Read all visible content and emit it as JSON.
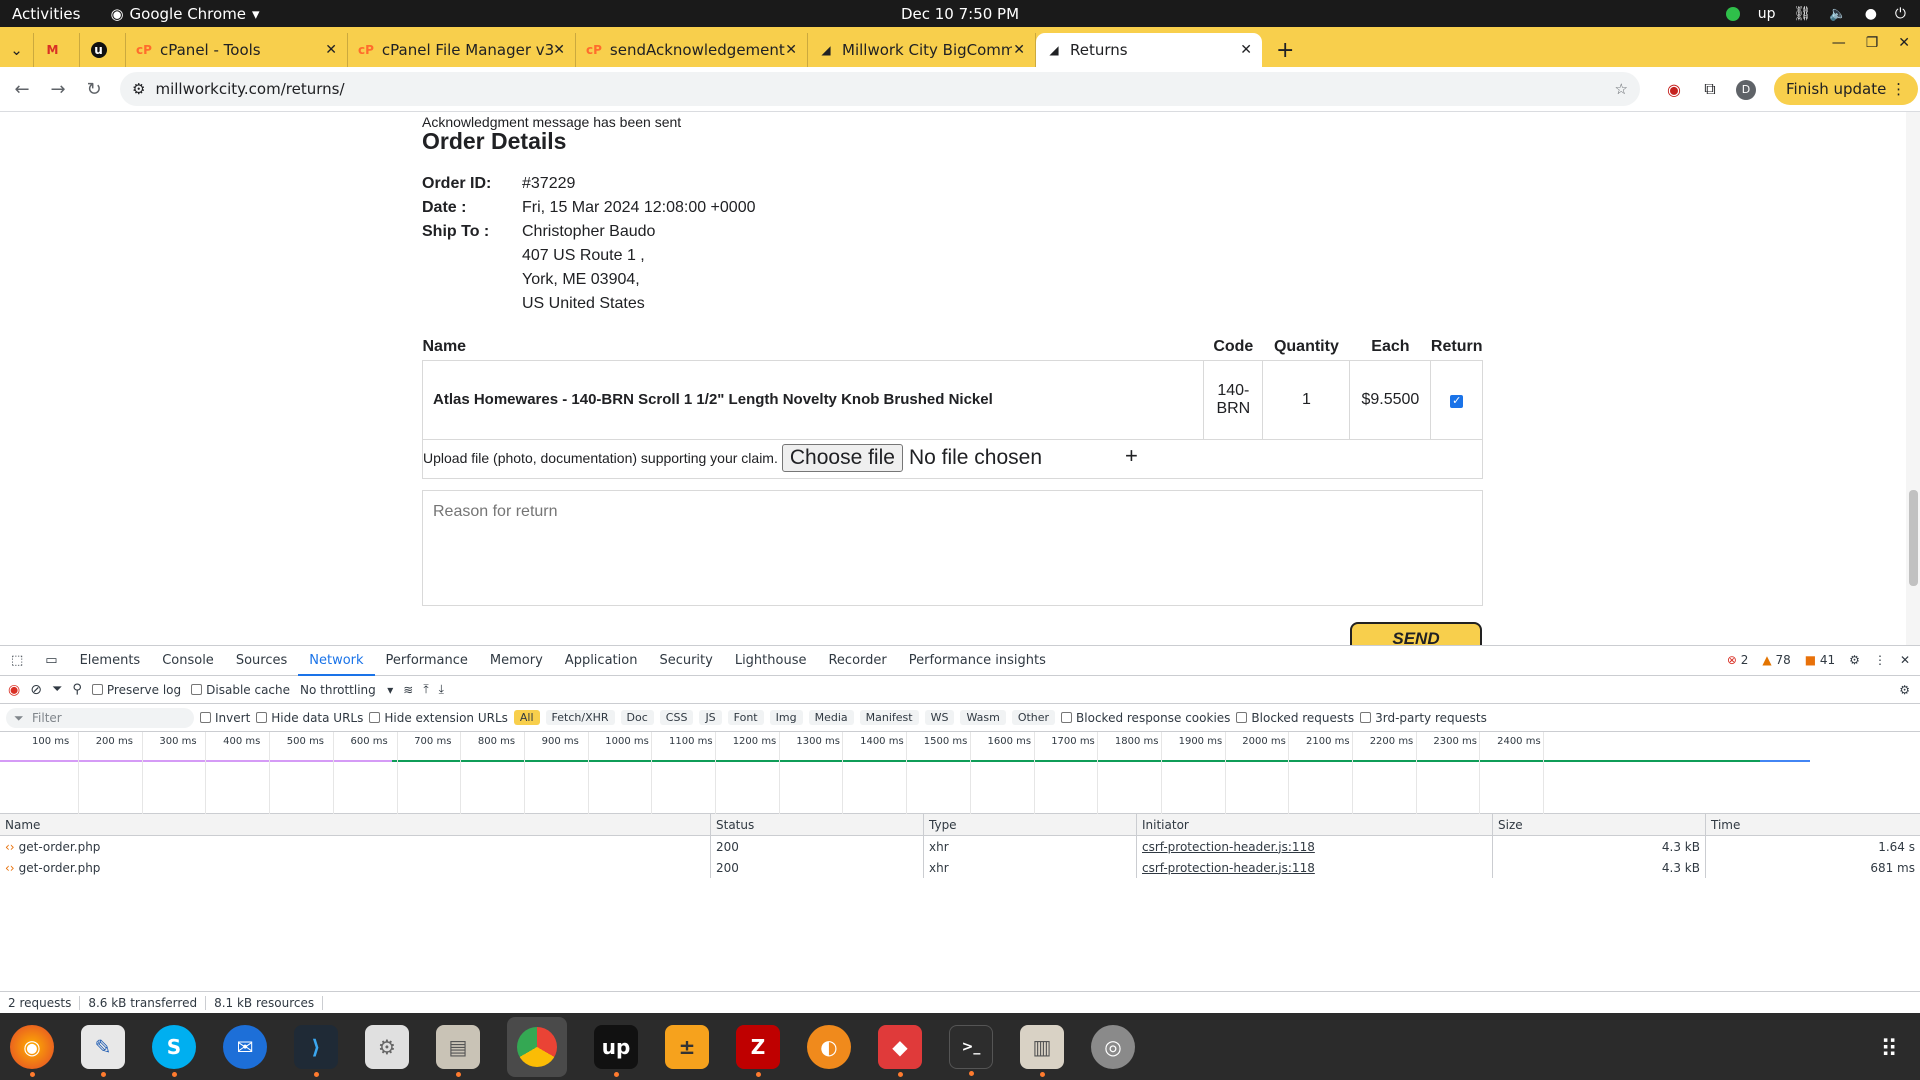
{
  "system": {
    "activities": "Activities",
    "app_name": "Google Chrome",
    "clock": "Dec 10  7:50 PM"
  },
  "tabs": [
    {
      "label": "cPanel - Tools"
    },
    {
      "label": "cPanel File Manager v3"
    },
    {
      "label": "sendAcknowledgement."
    },
    {
      "label": "Millwork City BigComme"
    },
    {
      "label": "Returns"
    }
  ],
  "address": {
    "url": "millworkcity.com/returns/",
    "finish_update": "Finish update",
    "profile_initial": "D"
  },
  "page": {
    "ack_message": "Acknowledgment message has been sent",
    "title": "Order Details",
    "order_id_label": "Order ID:",
    "order_id": "#37229",
    "date_label": "Date :",
    "date": "Fri, 15 Mar 2024 12:08:00 +0000",
    "ship_to_label": "Ship To :",
    "ship_name": "Christopher Baudo",
    "ship_line1": "407 US Route 1 ,",
    "ship_line2": "York, ME 03904,",
    "ship_line3": "US United States",
    "table": {
      "headers": [
        "Name",
        "Code",
        "Quantity",
        "Each",
        "Return"
      ],
      "row": {
        "name": "Atlas Homewares - 140-BRN Scroll 1 1/2\" Length Novelty Knob Brushed Nickel",
        "code_1": "140-",
        "code_2": "BRN",
        "quantity": "1",
        "each": "$9.5500",
        "return_checked": true
      }
    },
    "upload_label": "Upload file (photo, documentation) supporting your claim.",
    "choose_file": "Choose file",
    "no_file": "No file chosen",
    "reason_placeholder": "Reason for return",
    "send_button": "SEND REQUEST"
  },
  "devtools": {
    "tabs": [
      "Elements",
      "Console",
      "Sources",
      "Network",
      "Performance",
      "Memory",
      "Application",
      "Security",
      "Lighthouse",
      "Recorder",
      "Performance insights"
    ],
    "active_tab": "Network",
    "errors": "2",
    "warnings": "78",
    "issues": "41",
    "preserve_log": "Preserve log",
    "disable_cache": "Disable cache",
    "throttling": "No throttling",
    "filter_placeholder": "Filter",
    "invert": "Invert",
    "hide_data_urls": "Hide data URLs",
    "hide_ext_urls": "Hide extension URLs",
    "types": [
      "All",
      "Fetch/XHR",
      "Doc",
      "CSS",
      "JS",
      "Font",
      "Img",
      "Media",
      "Manifest",
      "WS",
      "Wasm",
      "Other"
    ],
    "blocked_cookies": "Blocked response cookies",
    "blocked_requests": "Blocked requests",
    "third_party": "3rd-party requests",
    "ticks": [
      "100 ms",
      "200 ms",
      "300 ms",
      "400 ms",
      "500 ms",
      "600 ms",
      "700 ms",
      "800 ms",
      "900 ms",
      "1000 ms",
      "1100 ms",
      "1200 ms",
      "1300 ms",
      "1400 ms",
      "1500 ms",
      "1600 ms",
      "1700 ms",
      "1800 ms",
      "1900 ms",
      "2000 ms",
      "2100 ms",
      "2200 ms",
      "2300 ms",
      "2400 ms"
    ],
    "columns": [
      "Name",
      "Status",
      "Type",
      "Initiator",
      "Size",
      "Time"
    ],
    "rows": [
      {
        "name": "get-order.php",
        "status": "200",
        "type": "xhr",
        "initiator": "csrf-protection-header.js:118",
        "size": "4.3 kB",
        "time": "1.64 s"
      },
      {
        "name": "get-order.php",
        "status": "200",
        "type": "xhr",
        "initiator": "csrf-protection-header.js:118",
        "size": "4.3 kB",
        "time": "681 ms"
      }
    ],
    "status": {
      "requests": "2 requests",
      "transferred": "8.6 kB transferred",
      "resources": "8.1 kB resources"
    }
  },
  "dock": [
    "firefox-icon",
    "text-editor-icon",
    "skype-icon",
    "thunderbird-icon",
    "vscode-icon",
    "settings-icon",
    "files-icon",
    "chrome-icon",
    "upwork-icon",
    "calculator-icon",
    "filezilla-icon",
    "blender-icon",
    "anydesk-icon",
    "terminal-icon",
    "archive-icon",
    "disk-icon"
  ],
  "colors": {
    "accent": "#f8cf4c",
    "link": "#1a73e8"
  }
}
